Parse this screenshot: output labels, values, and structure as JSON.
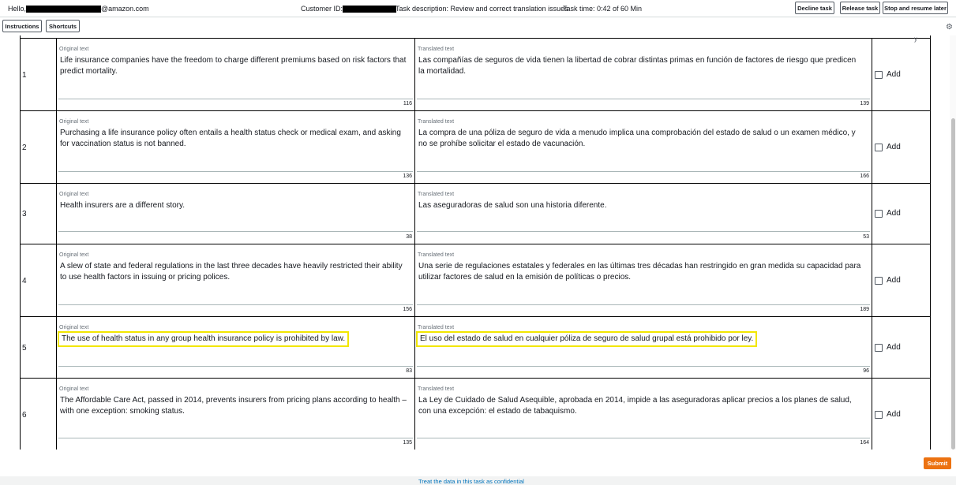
{
  "header": {
    "hello": "Hello,",
    "email_suffix": "@amazon.com",
    "customer_id_label": "Customer ID:",
    "task_description": "Task description: Review and correct translation issues",
    "task_time": "Task time: 0:42 of 60 Min",
    "decline_label": "Decline task",
    "release_label": "Release task",
    "stop_label": "Stop and resume later"
  },
  "toolbar": {
    "instructions_label": "Instructions",
    "shortcuts_label": "Shortcuts",
    "settings_icon": "gear-icon"
  },
  "table": {
    "original_label": "Original text",
    "translated_label": "Translated text",
    "add_label": "Add",
    "rows": [
      {
        "num": "1",
        "original": "Life insurance companies have the freedom to charge different premiums based on risk factors that predict mortality.",
        "original_count": "116",
        "translated": "Las compañías de seguros de vida tienen la libertad de cobrar distintas primas en función de factores de riesgo que predicen la mortalidad.",
        "translated_count": "139"
      },
      {
        "num": "2",
        "original": "Purchasing a life insurance policy often entails a health status check or medical exam, and asking for vaccination status is not banned.",
        "original_count": "136",
        "translated": "La compra de una póliza de seguro de vida a menudo implica una comprobación del estado de salud o un examen médico, y no se prohíbe solicitar el estado de vacunación.",
        "translated_count": "166"
      },
      {
        "num": "3",
        "original": "Health insurers are a different story.",
        "original_count": "38",
        "translated": "Las aseguradoras de salud son una historia diferente.",
        "translated_count": "53"
      },
      {
        "num": "4",
        "original": "A slew of state and federal regulations in the last three decades have heavily restricted their ability to use health factors in issuing or pricing polices.",
        "original_count": "156",
        "translated": "Una serie de regulaciones estatales y federales en las últimas tres décadas han restringido en gran medida su capacidad para utilizar factores de salud en la emisión de políticas o precios.",
        "translated_count": "189"
      },
      {
        "num": "5",
        "original": "The use of health status in any group health insurance policy is prohibited by law.",
        "original_count": "83",
        "translated": "El uso del estado de salud en cualquier póliza de seguro de salud grupal está prohibido por ley.",
        "translated_count": "96"
      },
      {
        "num": "6",
        "original": "The Affordable Care Act, passed in 2014, prevents insurers from pricing plans according to health – with one exception: smoking status.",
        "original_count": "135",
        "translated": "La Ley de Cuidado de Salud Asequible, aprobada en 2014, impide a las aseguradoras aplicar precios a los planes de salud, con una excepción: el estado de tabaquismo.",
        "translated_count": "164"
      }
    ]
  },
  "footer": {
    "submit_label": "Submit",
    "confidential_link": "Treat the data in this task as confidential"
  },
  "colors": {
    "highlight": "#f2e600",
    "submit_bg": "#ec7211",
    "link": "#0073bb"
  }
}
